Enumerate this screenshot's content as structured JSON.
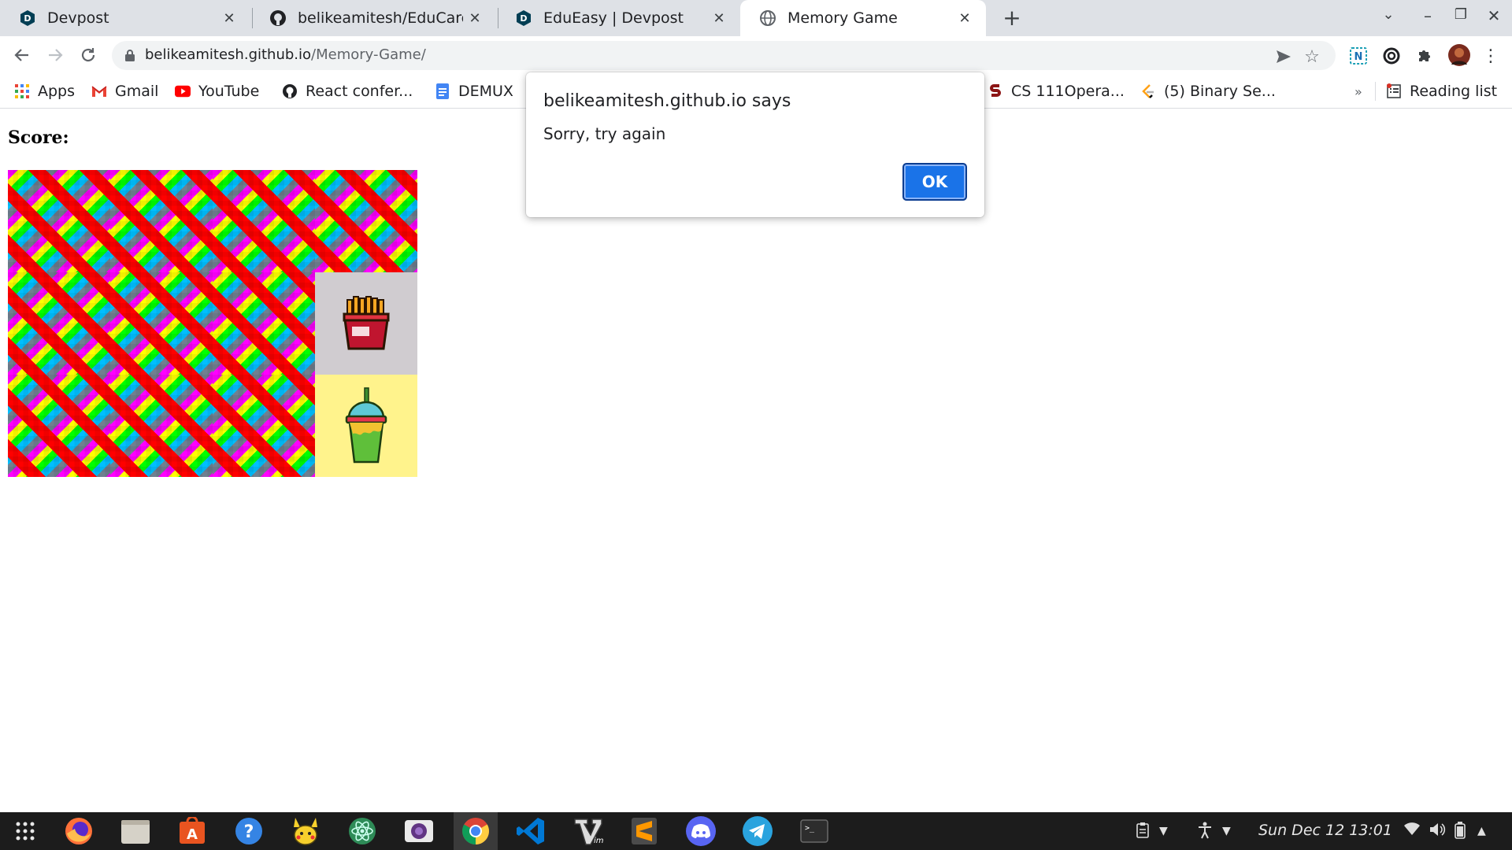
{
  "browser": {
    "tabs": [
      {
        "title": "Devpost",
        "favicon": "devpost-icon"
      },
      {
        "title": "belikeamitesh/EduCare",
        "favicon": "github-icon"
      },
      {
        "title": "EduEasy | Devpost",
        "favicon": "devpost-icon"
      },
      {
        "title": "Memory Game",
        "favicon": "globe-icon",
        "active": true
      }
    ],
    "url_host": "belikeamitesh.github.io",
    "url_path": "/Memory-Game/",
    "bookmarks": [
      {
        "label": "Apps",
        "icon": "apps-grid-icon"
      },
      {
        "label": "Gmail",
        "icon": "gmail-icon"
      },
      {
        "label": "YouTube",
        "icon": "youtube-icon"
      },
      {
        "label": "React confer...",
        "icon": "github-icon"
      },
      {
        "label": "DEMUX",
        "icon": "docs-icon"
      },
      {
        "label": "CS 111Opera...",
        "icon": "stanford-icon"
      },
      {
        "label": "(5) Binary Se...",
        "icon": "leetcode-icon"
      }
    ],
    "more_bookmarks": "»",
    "reading_list": "Reading list"
  },
  "page": {
    "score_label": "Score:",
    "cards": [
      "back",
      "back",
      "back",
      "back",
      "back",
      "back",
      "back",
      "fries",
      "back",
      "back",
      "back",
      "drink"
    ]
  },
  "dialog": {
    "title": "belikeamitesh.github.io says",
    "message": "Sorry, try again",
    "ok_label": "OK"
  },
  "taskbar": {
    "apps": [
      "app-grid-icon",
      "firefox-icon",
      "files-icon",
      "software-center-icon",
      "help-icon",
      "pikachu-icon",
      "atom-icon",
      "screenshot-icon",
      "chrome-icon",
      "vscode-icon",
      "vim-icon",
      "sublime-icon",
      "discord-icon",
      "telegram-icon",
      "terminal-icon"
    ],
    "clock": "Sun Dec 12  13:01"
  },
  "colors": {
    "accent": "#1a73e8",
    "tabstrip": "#dee1e6",
    "taskbar": "#1c1c1c"
  }
}
